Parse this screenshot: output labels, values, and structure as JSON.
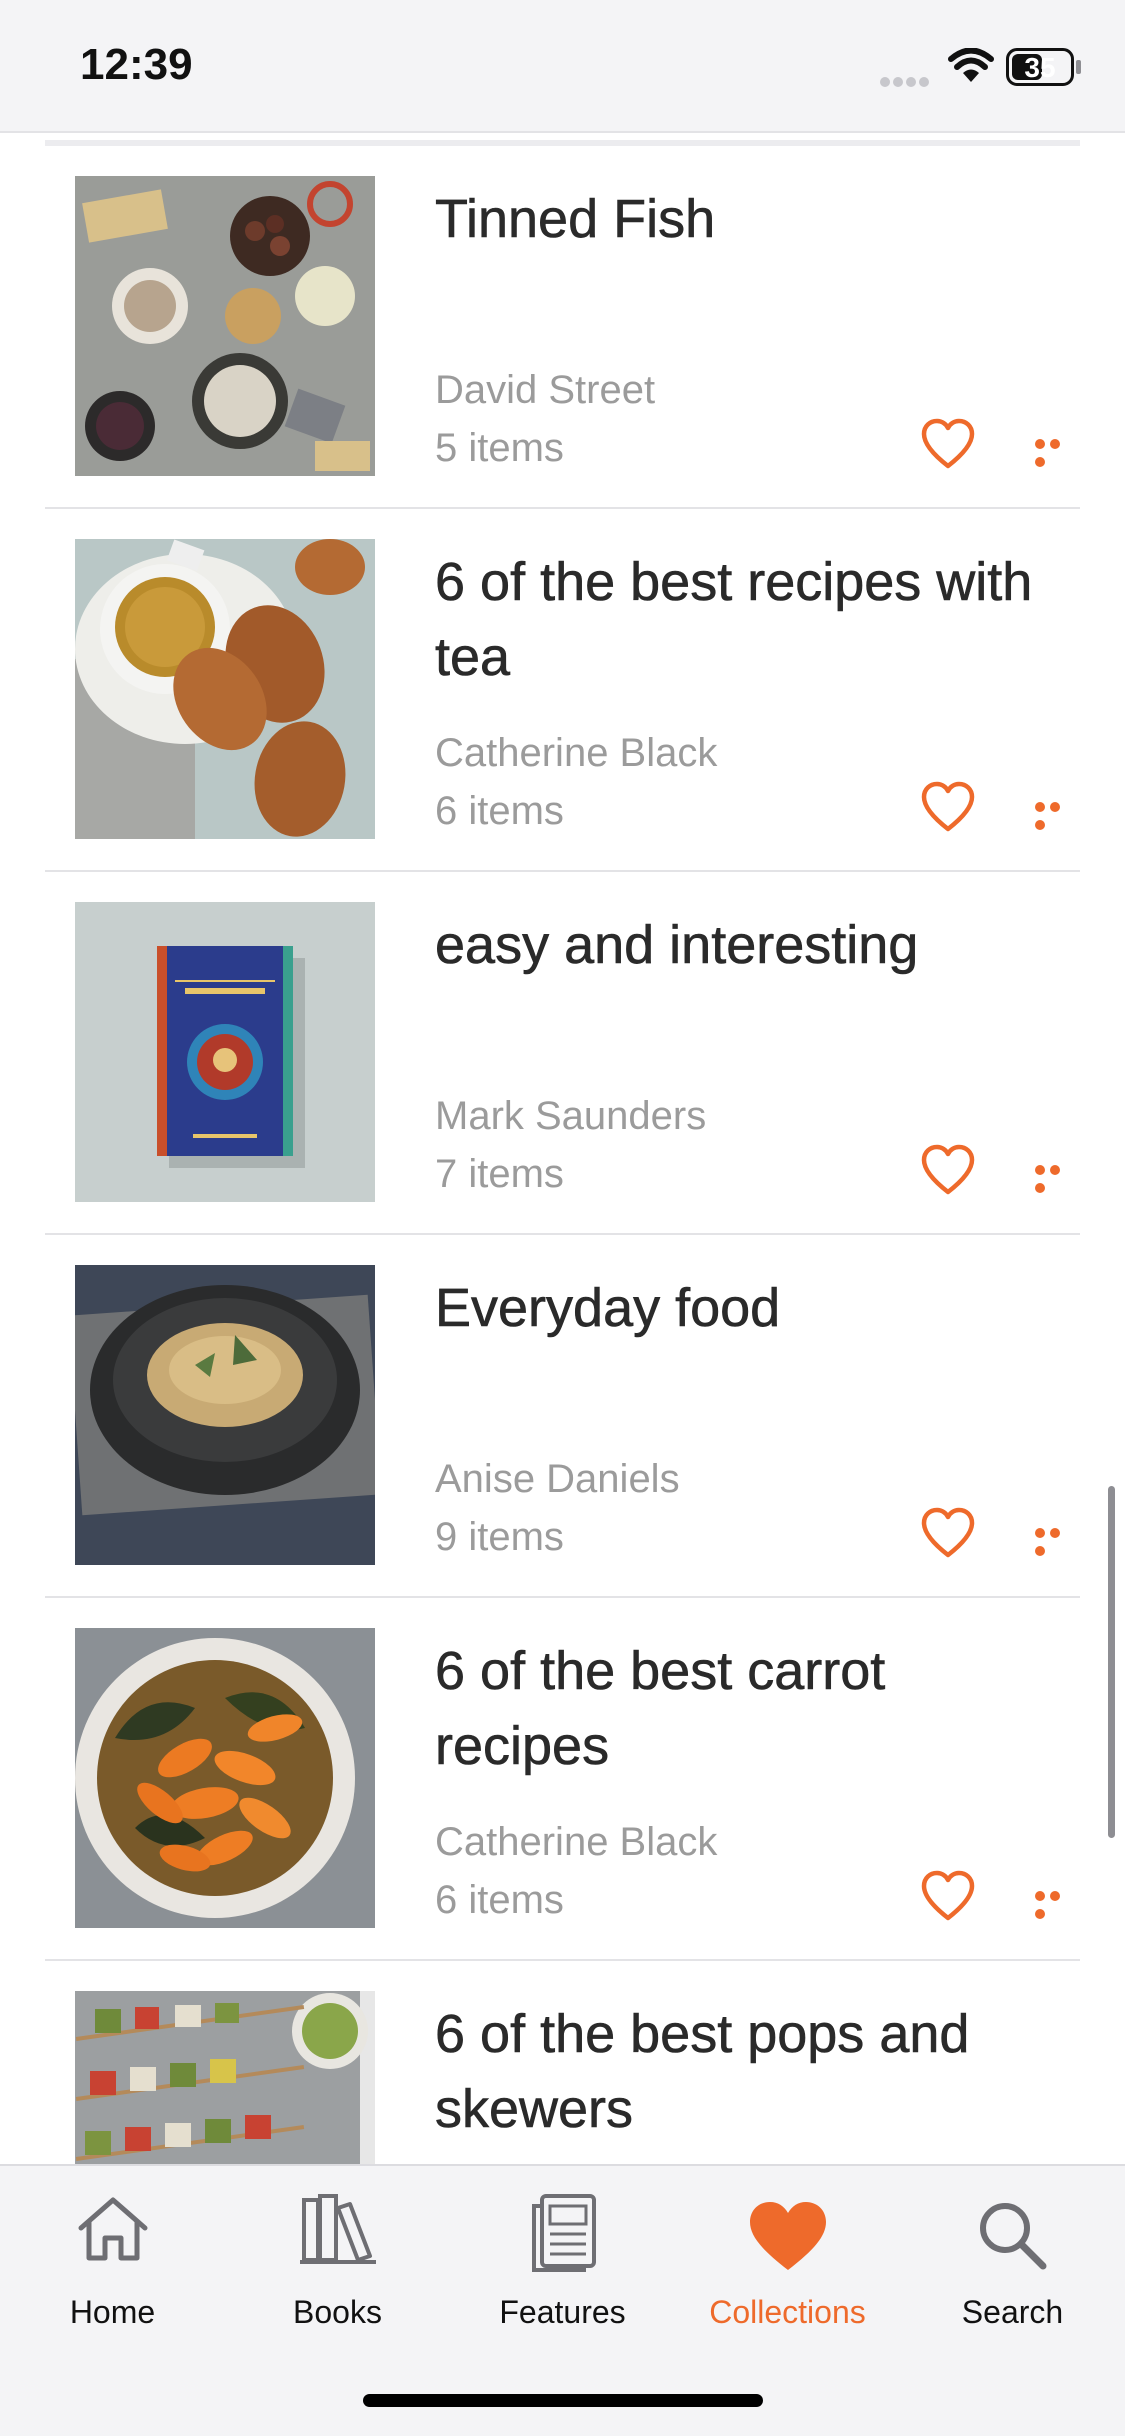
{
  "status_bar": {
    "time": "12:39",
    "battery": "35"
  },
  "collections": [
    {
      "title": "Tinned Fish",
      "author": "David Street",
      "count": "5 items",
      "thumb": "tinned-fish"
    },
    {
      "title": "6 of the best recipes with tea",
      "author": "Catherine Black",
      "count": "6 items",
      "thumb": "tea"
    },
    {
      "title": "easy and interesting",
      "author": "Mark Saunders",
      "count": "7 items",
      "thumb": "students-cookbook"
    },
    {
      "title": "Everyday food",
      "author": "Anise Daniels",
      "count": "9 items",
      "thumb": "noodles"
    },
    {
      "title": "6 of the best carrot recipes",
      "author": "Catherine Black",
      "count": "6 items",
      "thumb": "carrots"
    },
    {
      "title": "6 of the best pops and skewers",
      "author": "",
      "count": "",
      "thumb": "skewers"
    }
  ],
  "tabbar": {
    "tabs": [
      {
        "label": "Home",
        "icon": "house-icon"
      },
      {
        "label": "Books",
        "icon": "books-icon"
      },
      {
        "label": "Features",
        "icon": "newspaper-icon"
      },
      {
        "label": "Collections",
        "icon": "heart-icon",
        "active": true
      },
      {
        "label": "Search",
        "icon": "magnifier-icon"
      }
    ]
  },
  "colors": {
    "accent": "#ee6a2b",
    "text": "#2a2a2a",
    "muted": "#9b9b9b",
    "bar_bg": "#f4f4f6"
  }
}
